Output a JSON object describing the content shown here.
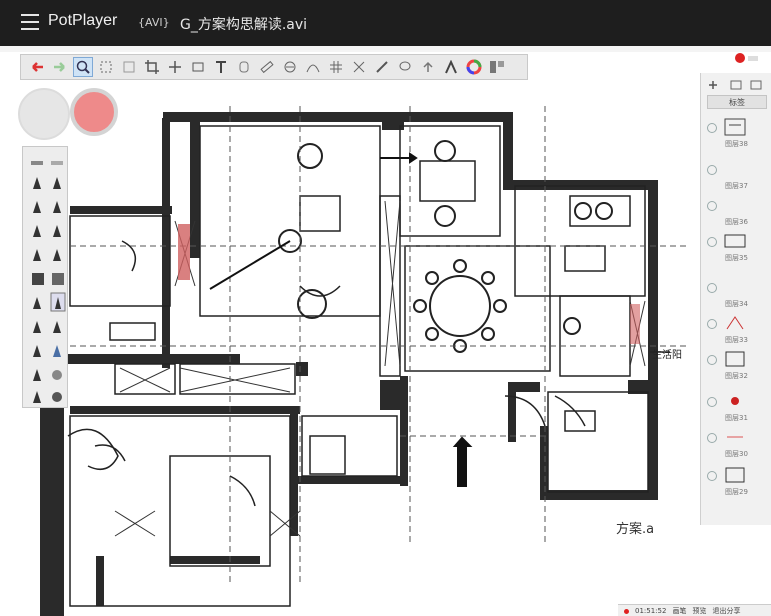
{
  "titlebar": {
    "app_name": "PotPlayer",
    "format_tag": "{AVI}",
    "file_name": "G_方案构思解读.avi"
  },
  "toolbar": {
    "icons": [
      "undo-arrow",
      "redo-arrow",
      "zoom",
      "selection",
      "transform",
      "crop",
      "move",
      "rect-select",
      "text",
      "text-vertical",
      "ruler",
      "ellipse",
      "curve",
      "grid",
      "symmetry",
      "brush-line",
      "lasso",
      "upload",
      "paint",
      "color-wheel",
      "panels"
    ]
  },
  "colors": {
    "primary_swatch": "#e6e6e6",
    "secondary_swatch": "#ee8a8a"
  },
  "layers": {
    "header_button": "标签",
    "items": [
      "图层38",
      "图层37",
      "图层36",
      "图层35",
      "图层34",
      "图层33",
      "图层32",
      "图层31",
      "图层30",
      "图层29"
    ]
  },
  "plan_labels": {
    "annotation_right": "生活阳",
    "signature": "方案.a"
  },
  "status_bar": {
    "time": "01:51:52",
    "btn1": "画笔",
    "btn2": "预览",
    "btn3": "退出分享"
  }
}
